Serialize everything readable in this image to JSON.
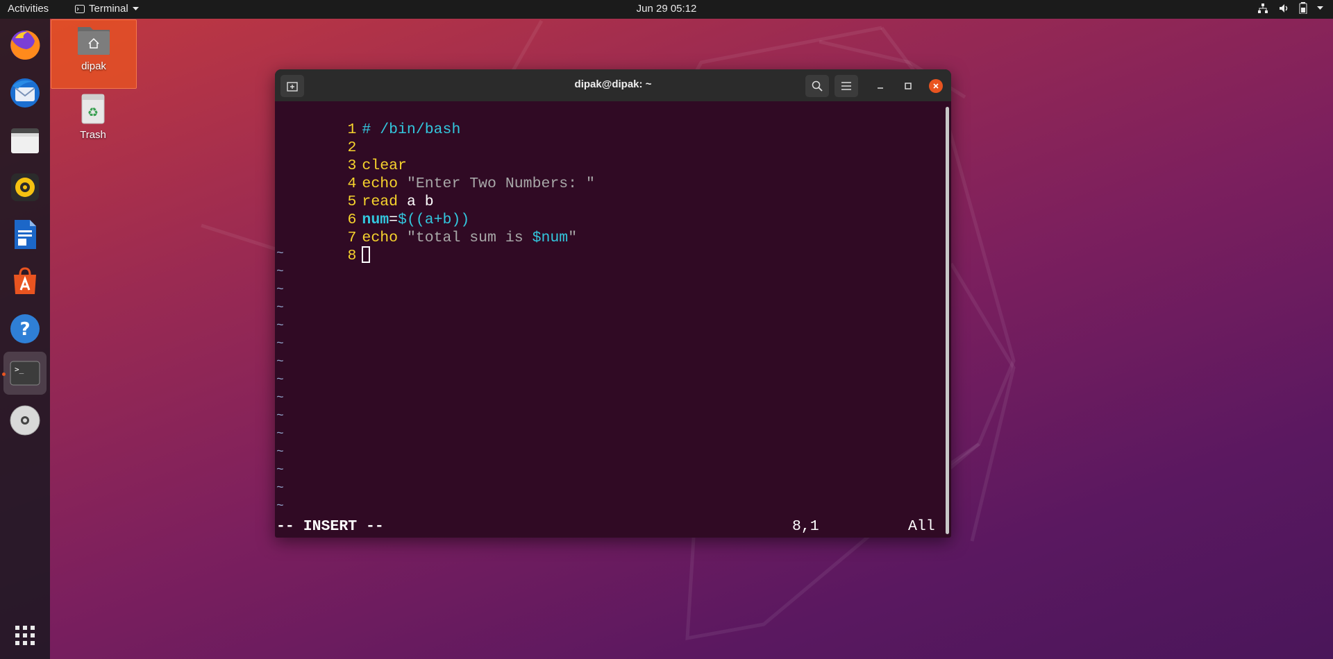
{
  "topbar": {
    "activities": "Activities",
    "app_name": "Terminal",
    "clock": "Jun 29  05:12"
  },
  "desktop": {
    "home_label": "dipak",
    "trash_label": "Trash"
  },
  "terminal": {
    "title": "dipak@dipak: ~",
    "lines": [
      {
        "num": "1",
        "parts": [
          "# /bin/bash"
        ]
      },
      {
        "num": "2"
      },
      {
        "num": "3",
        "text": "clear"
      },
      {
        "num": "4",
        "cmd": "echo",
        "str": "\"Enter Two Numbers: \""
      },
      {
        "num": "5",
        "cmd": "read",
        "args": "a b"
      },
      {
        "num": "6",
        "var": "num",
        "eq": "=",
        "expr": "$((a+b))"
      },
      {
        "num": "7",
        "cmd": "echo",
        "str_a": "\"total sum is ",
        "strvar": "$num",
        "str_b": "\""
      },
      {
        "num": "8"
      }
    ],
    "tilde": "~",
    "status_mode": "-- INSERT --",
    "cursor_position": "8,1",
    "scroll_state": "All"
  },
  "colors": {
    "terminal_bg": "#300a24",
    "line_number": "#f6d32d",
    "accent": "#e95420"
  }
}
